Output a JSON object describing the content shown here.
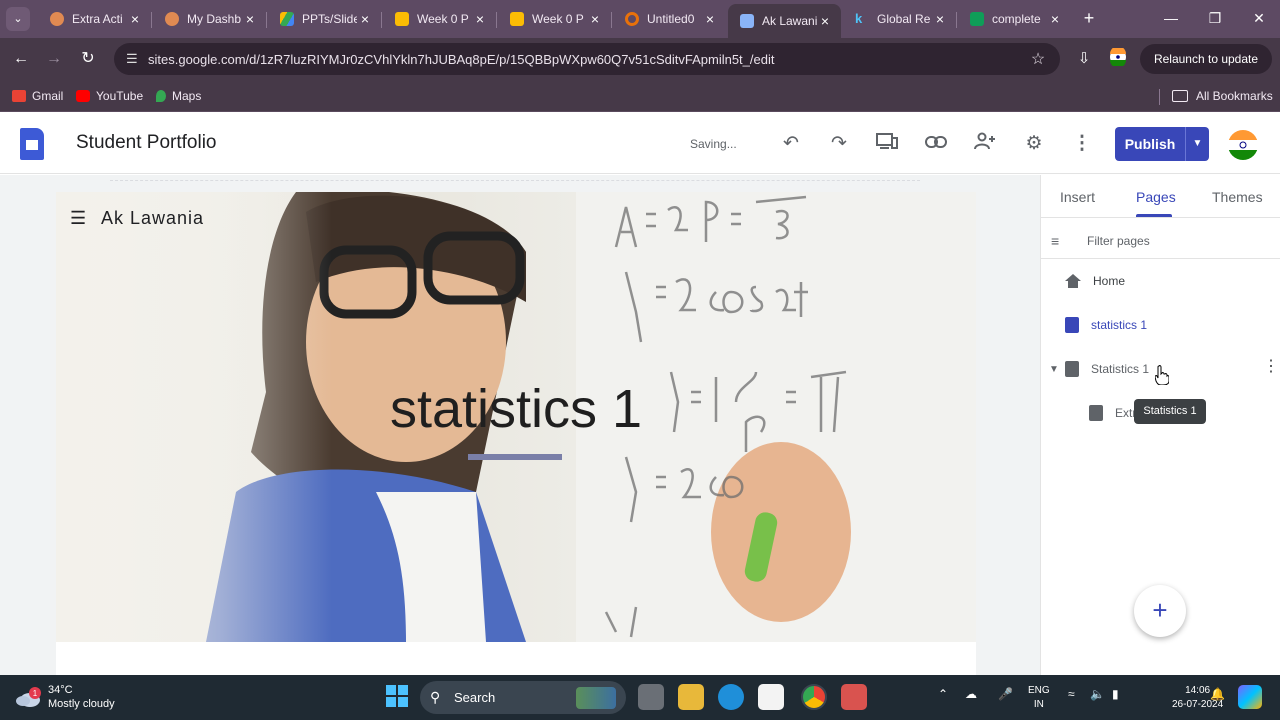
{
  "browser": {
    "tabs": [
      {
        "label": "Extra Acti",
        "color": "#e08a52"
      },
      {
        "label": "My Dashb",
        "color": "#e08a52"
      },
      {
        "label": "PPTs/Slide",
        "color": "#34a853"
      },
      {
        "label": "Week 0 P",
        "color": "#fbbc04"
      },
      {
        "label": "Week 0 P",
        "color": "#fbbc04"
      },
      {
        "label": "Untitled0",
        "color": "#e8710a"
      },
      {
        "label": "Ak Lawani",
        "color": "#4285f4"
      },
      {
        "label": "Global Re",
        "color": "#1a73e8"
      },
      {
        "label": "complete",
        "color": "#0f9d58"
      }
    ],
    "url": "sites.google.com/d/1zR7luzRIYMJr0zCVhlYkln7hJUBAq8pE/p/15QBBpWXpw60Q7v51cSditvFApmiln5t_/edit",
    "relaunch_label": "Relaunch to update",
    "bookmarks": [
      {
        "label": "Gmail",
        "color": "#ea4335"
      },
      {
        "label": "YouTube",
        "color": "#ff0000"
      },
      {
        "label": "Maps",
        "color": "#34a853"
      }
    ],
    "all_bookmarks_label": "All Bookmarks"
  },
  "sites": {
    "site_title": "Student Portfolio",
    "saving_status": "Saving...",
    "publish_label": "Publish",
    "hero": {
      "site_name": "Ak Lawania",
      "title": "statistics 1"
    },
    "panel": {
      "tabs": [
        "Insert",
        "Pages",
        "Themes"
      ],
      "active_tab": "Pages",
      "filter_placeholder": "Filter pages",
      "pages": [
        {
          "label": "Home",
          "icon": "home-icon"
        },
        {
          "label": "statistics 1",
          "icon": "page-icon"
        },
        {
          "label": "Statistics 1",
          "icon": "page-icon"
        },
        {
          "label": "Extr",
          "icon": "page-icon"
        }
      ],
      "tooltip": "Statistics 1"
    }
  },
  "taskbar": {
    "weather_temp": "34°C",
    "weather_desc": "Mostly cloudy",
    "weather_badge": "1",
    "search_label": "Search",
    "lang_top": "ENG",
    "lang_bottom": "IN",
    "time": "14:06",
    "date": "26-07-2024"
  }
}
